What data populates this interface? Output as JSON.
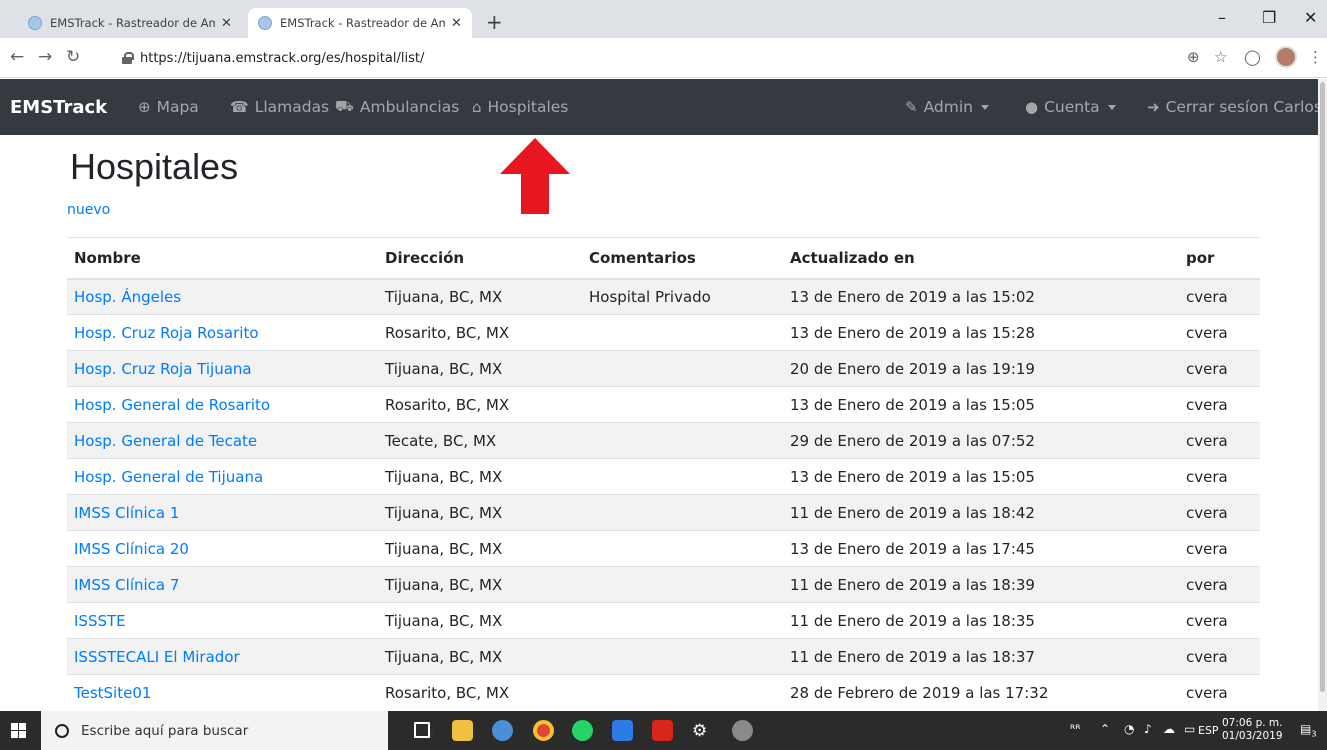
{
  "browser": {
    "tabs": [
      {
        "title": "EMSTrack - Rastreador de Ambul",
        "active": false
      },
      {
        "title": "EMSTrack - Rastreador de Ambul",
        "active": true
      }
    ],
    "url": "https://tijuana.emstrack.org/es/hospital/list/"
  },
  "navbar": {
    "brand": "EMSTrack",
    "items": [
      {
        "label": "Mapa",
        "icon": "globe-icon"
      },
      {
        "label": "Llamadas",
        "icon": "phone-icon"
      },
      {
        "label": "Ambulancias",
        "icon": "ambulance-icon"
      },
      {
        "label": "Hospitales",
        "icon": "hospital-icon"
      }
    ],
    "admin": "Admin",
    "account": "Cuenta",
    "logout": "Cerrar sesíon Carlos"
  },
  "page": {
    "title": "Hospitales",
    "new_link": "nuevo"
  },
  "table": {
    "headers": [
      "Nombre",
      "Dirección",
      "Comentarios",
      "Actualizado en",
      "por"
    ],
    "rows": [
      [
        "Hosp. Ángeles",
        "Tijuana, BC, MX",
        "Hospital Privado",
        "13 de Enero de 2019 a las 15:02",
        "cvera"
      ],
      [
        "Hosp. Cruz Roja Rosarito",
        "Rosarito, BC, MX",
        "",
        "13 de Enero de 2019 a las 15:28",
        "cvera"
      ],
      [
        "Hosp. Cruz Roja Tijuana",
        "Tijuana, BC, MX",
        "",
        "20 de Enero de 2019 a las 19:19",
        "cvera"
      ],
      [
        "Hosp. General de Rosarito",
        "Rosarito, BC, MX",
        "",
        "13 de Enero de 2019 a las 15:05",
        "cvera"
      ],
      [
        "Hosp. General de Tecate",
        "Tecate, BC, MX",
        "",
        "29 de Enero de 2019 a las 07:52",
        "cvera"
      ],
      [
        "Hosp. General de Tijuana",
        "Tijuana, BC, MX",
        "",
        "13 de Enero de 2019 a las 15:05",
        "cvera"
      ],
      [
        "IMSS Clínica 1",
        "Tijuana, BC, MX",
        "",
        "11 de Enero de 2019 a las 18:42",
        "cvera"
      ],
      [
        "IMSS Clínica 20",
        "Tijuana, BC, MX",
        "",
        "13 de Enero de 2019 a las 17:45",
        "cvera"
      ],
      [
        "IMSS Clínica 7",
        "Tijuana, BC, MX",
        "",
        "11 de Enero de 2019 a las 18:39",
        "cvera"
      ],
      [
        "ISSSTE",
        "Tijuana, BC, MX",
        "",
        "11 de Enero de 2019 a las 18:35",
        "cvera"
      ],
      [
        "ISSSTECALI El Mirador",
        "Tijuana, BC, MX",
        "",
        "11 de Enero de 2019 a las 18:37",
        "cvera"
      ],
      [
        "TestSite01",
        "Rosarito, BC, MX",
        "",
        "28 de Febrero de 2019 a las 17:32",
        "cvera"
      ]
    ]
  },
  "taskbar": {
    "search_placeholder": "Escribe aquí para buscar",
    "language": "ESP",
    "time": "07:06 p. m.",
    "date": "01/03/2019",
    "notification_count": "3"
  },
  "colors": {
    "navbar_bg": "#343a40",
    "link": "#007bff",
    "arrow": "#e8161e"
  }
}
